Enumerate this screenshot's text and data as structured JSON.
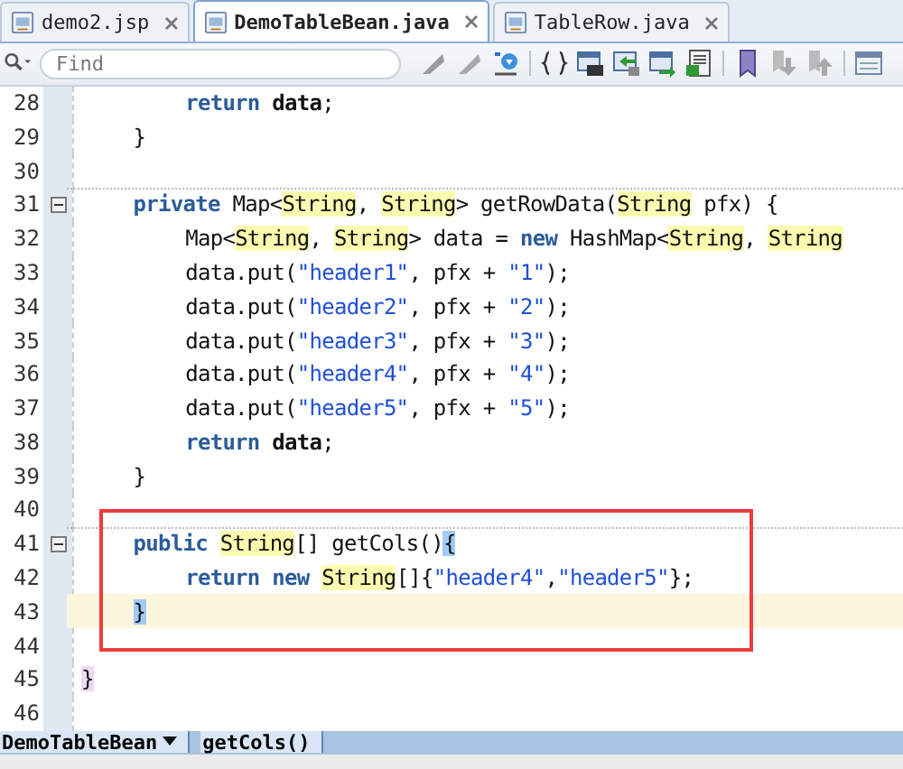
{
  "tabs": [
    {
      "label": "demo2.jsp",
      "selected": false
    },
    {
      "label": "DemoTableBean.java",
      "selected": true
    },
    {
      "label": "TableRow.java",
      "selected": false
    }
  ],
  "find": {
    "placeholder": "Find"
  },
  "lines": [
    {
      "n": "28",
      "fold": false,
      "sep": false,
      "current": false,
      "in_class": true,
      "in_method": true,
      "tokens": [
        {
          "keyword": "return "
        },
        {
          "bold": "data"
        },
        {
          "text": ";"
        }
      ]
    },
    {
      "n": "29",
      "fold": false,
      "sep": false,
      "current": false,
      "in_class": true,
      "in_method": false,
      "tokens": [
        {
          "text": "}"
        }
      ]
    },
    {
      "n": "30",
      "fold": false,
      "sep": false,
      "current": false
    },
    {
      "n": "31",
      "fold": true,
      "sep": true,
      "current": false,
      "in_class": true,
      "in_method": false,
      "tokens": [
        {
          "keyword": "private"
        },
        {
          "text": " Map<"
        },
        {
          "type": "String"
        },
        {
          "text": ", "
        },
        {
          "type": "String"
        },
        {
          "text": "> getRowData("
        },
        {
          "type": "String"
        },
        {
          "text": " pfx) {"
        }
      ]
    },
    {
      "n": "32",
      "fold": false,
      "sep": false,
      "current": false,
      "in_class": true,
      "in_method": true,
      "tokens": [
        {
          "text": "Map<"
        },
        {
          "type": "String"
        },
        {
          "text": ", "
        },
        {
          "type": "String"
        },
        {
          "text": "> data = "
        },
        {
          "keyword": "new"
        },
        {
          "text": " HashMap<"
        },
        {
          "type": "String"
        },
        {
          "text": ", "
        },
        {
          "type": "String"
        }
      ]
    },
    {
      "n": "33",
      "fold": false,
      "sep": false,
      "current": false,
      "in_class": true,
      "in_method": true,
      "tokens": [
        {
          "text": "data.put("
        },
        {
          "string": "\"header1\""
        },
        {
          "text": ", pfx + "
        },
        {
          "string": "\"1\""
        },
        {
          "text": ");"
        }
      ]
    },
    {
      "n": "34",
      "fold": false,
      "sep": false,
      "current": false,
      "in_class": true,
      "in_method": true,
      "tokens": [
        {
          "text": "data.put("
        },
        {
          "string": "\"header2\""
        },
        {
          "text": ", pfx + "
        },
        {
          "string": "\"2\""
        },
        {
          "text": ");"
        }
      ]
    },
    {
      "n": "35",
      "fold": false,
      "sep": false,
      "current": false,
      "in_class": true,
      "in_method": true,
      "tokens": [
        {
          "text": "data.put("
        },
        {
          "string": "\"header3\""
        },
        {
          "text": ", pfx + "
        },
        {
          "string": "\"3\""
        },
        {
          "text": ");"
        }
      ]
    },
    {
      "n": "36",
      "fold": false,
      "sep": false,
      "current": false,
      "in_class": true,
      "in_method": true,
      "tokens": [
        {
          "text": "data.put("
        },
        {
          "string": "\"header4\""
        },
        {
          "text": ", pfx + "
        },
        {
          "string": "\"4\""
        },
        {
          "text": ");"
        }
      ]
    },
    {
      "n": "37",
      "fold": false,
      "sep": false,
      "current": false,
      "in_class": true,
      "in_method": true,
      "tokens": [
        {
          "text": "data.put("
        },
        {
          "string": "\"header5\""
        },
        {
          "text": ", pfx + "
        },
        {
          "string": "\"5\""
        },
        {
          "text": ");"
        }
      ]
    },
    {
      "n": "38",
      "fold": false,
      "sep": false,
      "current": false,
      "in_class": true,
      "in_method": true,
      "tokens": [
        {
          "keyword": "return "
        },
        {
          "bold": "data"
        },
        {
          "text": ";"
        }
      ]
    },
    {
      "n": "39",
      "fold": false,
      "sep": false,
      "current": false,
      "in_class": true,
      "in_method": false,
      "tokens": [
        {
          "text": "}"
        }
      ]
    },
    {
      "n": "40",
      "fold": false,
      "sep": false,
      "current": false
    },
    {
      "n": "41",
      "fold": true,
      "sep": true,
      "current": false,
      "in_class": true,
      "in_method": false,
      "tokens": [
        {
          "keyword": "public "
        },
        {
          "type": "String"
        },
        {
          "text": "[] getCols()"
        },
        {
          "match": "{"
        }
      ]
    },
    {
      "n": "42",
      "fold": false,
      "sep": false,
      "current": false,
      "in_class": true,
      "in_method": true,
      "tokens": [
        {
          "keyword": "return new "
        },
        {
          "type": "String"
        },
        {
          "text": "[]{"
        },
        {
          "string": "\"header4\""
        },
        {
          "text": ","
        },
        {
          "string": "\"header5\""
        },
        {
          "text": "};"
        }
      ]
    },
    {
      "n": "43",
      "fold": false,
      "sep": false,
      "current": true,
      "in_class": true,
      "in_method": false,
      "tokens": [
        {
          "match": "}"
        }
      ]
    },
    {
      "n": "44",
      "fold": false,
      "sep": false,
      "current": false
    },
    {
      "n": "45",
      "fold": false,
      "sep": false,
      "current": false,
      "in_class": false,
      "in_method": false,
      "tokens": [
        {
          "close": "}"
        }
      ]
    },
    {
      "n": "46",
      "fold": false,
      "sep": false,
      "current": false
    }
  ],
  "breadcrumb": [
    {
      "label": "DemoTableBean",
      "dropdown": true
    },
    {
      "label": "getCols()",
      "dropdown": false
    }
  ]
}
